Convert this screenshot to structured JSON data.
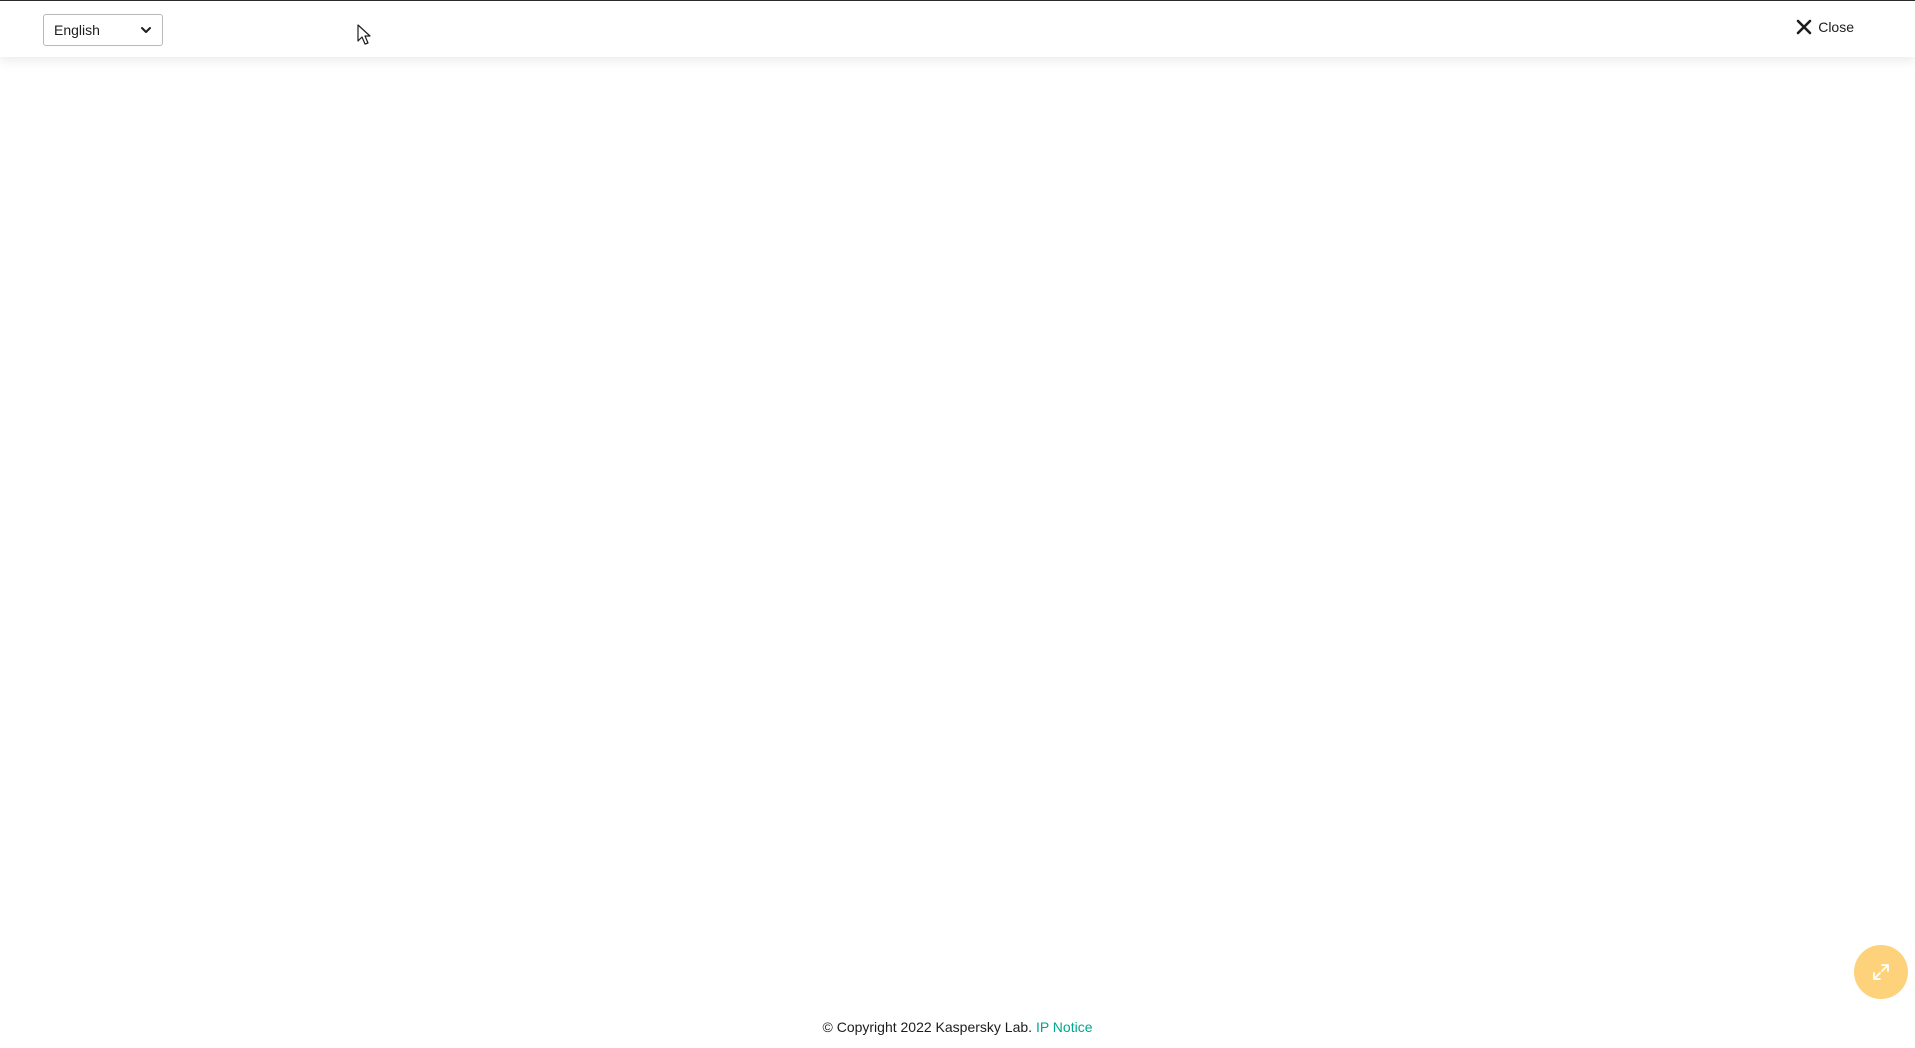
{
  "header": {
    "language_select": {
      "selected": "English"
    },
    "close_label": "Close"
  },
  "footer": {
    "copyright": "© Copyright 2022 Kaspersky Lab.",
    "ip_notice_label": "IP Notice"
  },
  "colors": {
    "accent_link": "#00a88e",
    "fab_background": "#fdd27a"
  },
  "icons": {
    "language_dropdown": "chevron-down-icon",
    "close": "close-icon",
    "fab": "expand-icon"
  }
}
